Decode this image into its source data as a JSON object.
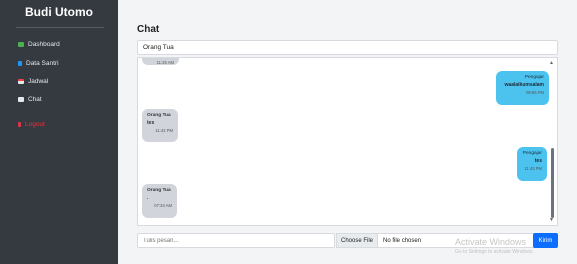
{
  "sidebar": {
    "brand": "Budi Utomo",
    "items": [
      {
        "label": "Dashboard",
        "icon": "dashboard-icon",
        "color": "#4caf50"
      },
      {
        "label": "Data Santri",
        "icon": "data-icon",
        "color": "#2196f3"
      },
      {
        "label": "Jadwal",
        "icon": "calendar-icon",
        "color": "#e5e7eb"
      },
      {
        "label": "Chat",
        "icon": "chat-icon",
        "color": "#e5e7eb"
      },
      {
        "label": "Logout",
        "icon": "logout-icon",
        "color": "#dc3545"
      }
    ]
  },
  "main": {
    "title": "Chat",
    "contact": "Orang Tua"
  },
  "messages": [
    {
      "direction": "in",
      "sender": "",
      "text": "",
      "time": "11:26 AM"
    },
    {
      "direction": "out",
      "sender": "Pengajar",
      "text": "waalaikumsalam",
      "time": "09:56 PM"
    },
    {
      "direction": "in",
      "sender": "Orang Tua",
      "text": "tes",
      "time": "11:42 PM"
    },
    {
      "direction": "out",
      "sender": "Pengajar",
      "text": "tes",
      "time": "11:43 PM"
    },
    {
      "direction": "in",
      "sender": "Orang Tua",
      "text": ".",
      "time": "07:34 AM"
    }
  ],
  "composer": {
    "placeholder": "Tulis pesan...",
    "file_button": "Choose File",
    "file_status": "No file chosen",
    "send_label": "Kirim"
  },
  "watermark": {
    "title": "Activate Windows",
    "subtitle": "Go to Settings to activate Windows."
  },
  "colors": {
    "sidebar_bg": "#343a40",
    "outgoing_bubble": "#4cc3ef",
    "incoming_bubble": "#d1d5db",
    "send_button": "#0d6efd",
    "logout": "#dc3545"
  }
}
